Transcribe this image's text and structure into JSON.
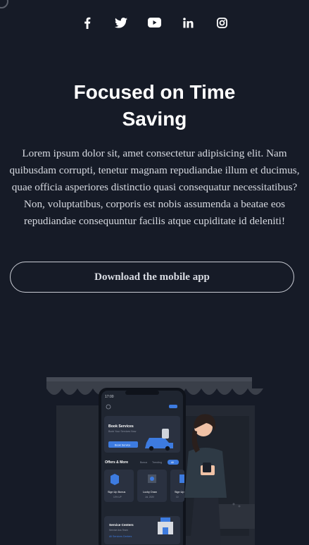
{
  "social": {
    "icons": [
      "facebook-icon",
      "twitter-icon",
      "youtube-icon",
      "linkedin-icon",
      "instagram-icon"
    ]
  },
  "hero": {
    "title_line1": "Focused on Time",
    "title_line2": "Saving",
    "description": "Lorem ipsum dolor sit, amet consectetur adipisicing elit. Nam quibusdam corrupti, tenetur magnam repudiandae illum et ducimus, quae officia asperiores distinctio quasi consequatur necessitatibus? Non, voluptatibus, corporis est nobis assumenda a beatae eos repudiandae consequuntur facilis atque cupiditate id deleniti!",
    "cta_label": "Download the mobile app"
  },
  "phone": {
    "time": "17:00",
    "book_title": "Book Services",
    "book_sub": "Book Your Services Now",
    "book_button": "Book Service",
    "offers_title": "Offers & More",
    "tabs": [
      "Bonus",
      "Trending",
      "All"
    ],
    "cards": [
      {
        "title": "Sign Up Bonus",
        "sub": "10% UP"
      },
      {
        "title": "Lucky Draw",
        "sub": "Jul, 2020"
      },
      {
        "title": "Sign Up B",
        "sub": "10"
      }
    ],
    "centers_title": "Service Centers",
    "centers_sub": "Service Ass Team",
    "centers_link": "All Services Centers"
  },
  "colors": {
    "background": "#161b27",
    "accent": "#3d7be0"
  }
}
